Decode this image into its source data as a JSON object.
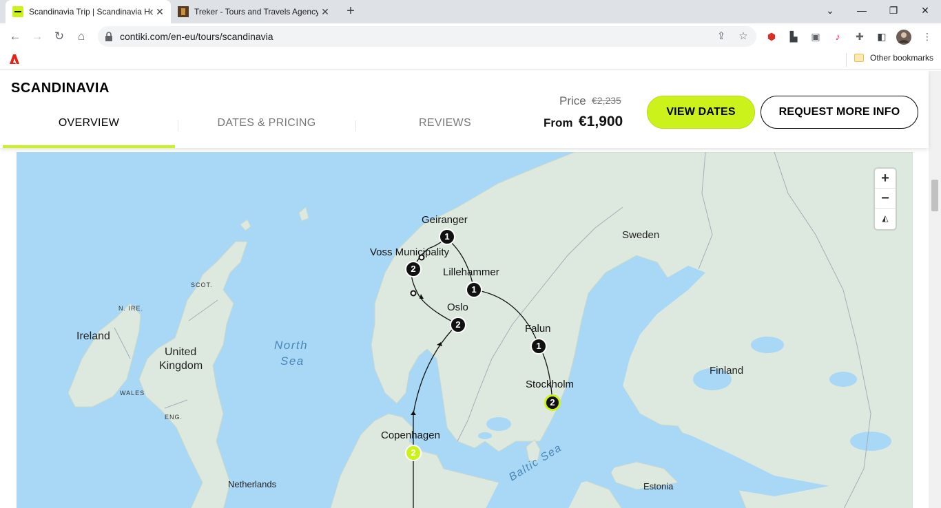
{
  "browser": {
    "tabs": [
      {
        "title": "Scandinavia Trip | Scandinavia Holidays",
        "active": true
      },
      {
        "title": "Treker - Tours and Travels Agency",
        "active": false
      }
    ],
    "url": "contiki.com/en-eu/tours/scandinavia",
    "bookmarks": {
      "other": "Other bookmarks"
    }
  },
  "trip": {
    "title": "SCANDINAVIA",
    "tabs": [
      "OVERVIEW",
      "DATES & PRICING",
      "REVIEWS"
    ],
    "price_label": "Price",
    "old_price": "€2,235",
    "from_label": "From",
    "price": "€1,900",
    "view_dates": "VIEW DATES",
    "request_info": "REQUEST MORE INFO"
  },
  "map": {
    "zoom_in": "+",
    "zoom_out": "−",
    "compass": "◭",
    "countries": {
      "sweden": "Sweden",
      "finland": "Finland",
      "ireland": "Ireland",
      "uk_line1": "United",
      "uk_line2": "Kingdom",
      "netherlands": "Netherlands",
      "estonia": "Estonia"
    },
    "regions": {
      "scot": "SCOT.",
      "nire": "N. IRE.",
      "wales": "WALES",
      "eng": "ENG."
    },
    "seas": {
      "north_line1": "North",
      "north_line2": "Sea",
      "baltic": "Baltic Sea"
    },
    "stops": {
      "geiranger": {
        "name": "Geiranger",
        "nights": "1"
      },
      "voss": {
        "name": "Voss Municipality",
        "nights": "2"
      },
      "lillehammer": {
        "name": "Lillehammer",
        "nights": "1"
      },
      "oslo": {
        "name": "Oslo",
        "nights": "2"
      },
      "falun": {
        "name": "Falun",
        "nights": "1"
      },
      "stockholm": {
        "name": "Stockholm",
        "nights": "2"
      },
      "copenhagen": {
        "name": "Copenhagen",
        "nights": "2"
      }
    },
    "colors": {
      "land": "#dde9df",
      "water": "#a8d8f5",
      "accent": "#ccf21c",
      "border": "#9fb0b6"
    }
  }
}
